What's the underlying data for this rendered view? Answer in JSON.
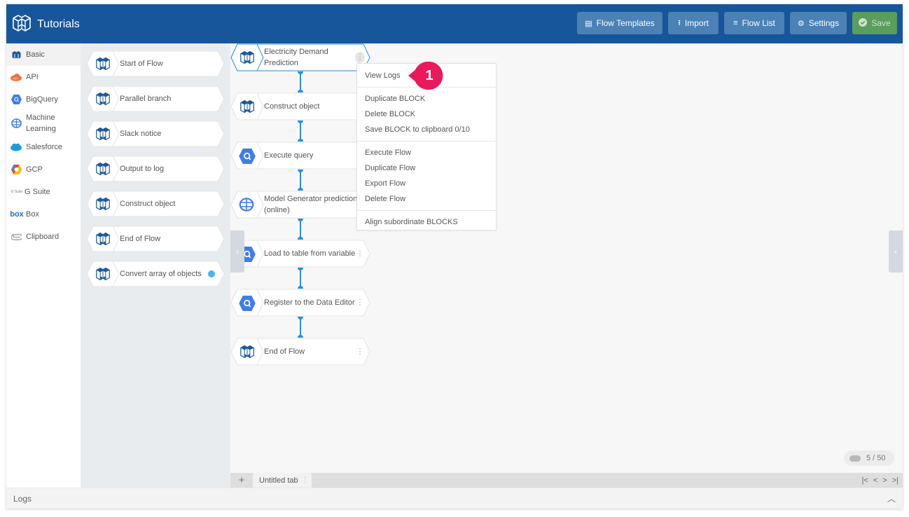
{
  "header": {
    "title": "Tutorials",
    "buttons": {
      "flow_templates": "Flow Templates",
      "import": "Import",
      "flow_list": "Flow List",
      "settings": "Settings",
      "save": "Save"
    }
  },
  "colors": {
    "header_bg": "#17569a",
    "header_button": "#4b81b5",
    "save_button": "#5a9e5d",
    "connector": "#2a8ee0",
    "callout": "#e8195c",
    "selected_block_border": "#2a8ee0"
  },
  "categories": [
    {
      "label": "Basic",
      "icon": "block-cube-icon",
      "active": true
    },
    {
      "label": "API",
      "icon": "api-cloud-icon"
    },
    {
      "label": "BigQuery",
      "icon": "bigquery-icon"
    },
    {
      "label": "Machine Learning",
      "icon": "brain-icon"
    },
    {
      "label": "Salesforce",
      "icon": "salesforce-cloud-icon"
    },
    {
      "label": "GCP",
      "icon": "gcp-hexagon-icon"
    },
    {
      "label": "G Suite",
      "icon": "gsuite-icon",
      "icon_text": "G Suite"
    },
    {
      "label": "Box",
      "icon": "box-logo-icon",
      "icon_text": "box"
    },
    {
      "label": "Clipboard",
      "icon": "paperclip-icon"
    }
  ],
  "palette": [
    {
      "label": "Start of Flow"
    },
    {
      "label": "Parallel branch"
    },
    {
      "label": "Slack notice"
    },
    {
      "label": "Output to log"
    },
    {
      "label": "Construct object"
    },
    {
      "label": "End of Flow"
    },
    {
      "label": "Convert array of objects",
      "badge": true
    }
  ],
  "flow": [
    {
      "label": "Electricity Demand Prediction",
      "icon": "block-cube-icon",
      "selected": true
    },
    {
      "label": "Construct object",
      "icon": "block-cube-icon"
    },
    {
      "label": "Execute query",
      "icon": "bigquery-icon"
    },
    {
      "label": "Model Generator prediction (online)",
      "icon": "brain-icon"
    },
    {
      "label": "Load to table from variable",
      "icon": "bigquery-icon"
    },
    {
      "label": "Register to the Data Editor",
      "icon": "bigquery-icon"
    },
    {
      "label": "End of Flow",
      "icon": "block-cube-icon"
    }
  ],
  "context_menu": {
    "groups": [
      [
        "View Logs"
      ],
      [
        "Duplicate BLOCK",
        "Delete BLOCK",
        "Save BLOCK to clipboard 0/10"
      ],
      [
        "Execute Flow",
        "Duplicate Flow",
        "Export Flow",
        "Delete Flow"
      ],
      [
        "Align subordinate BLOCKS"
      ]
    ]
  },
  "callout": {
    "number": "1"
  },
  "block_counter": "5 / 50",
  "tabs": [
    {
      "label": "Untitled tab"
    }
  ],
  "tab_nav": {
    "first": "|<",
    "prev": "<",
    "next": ">",
    "last": ">|"
  },
  "logs": {
    "label": "Logs"
  }
}
